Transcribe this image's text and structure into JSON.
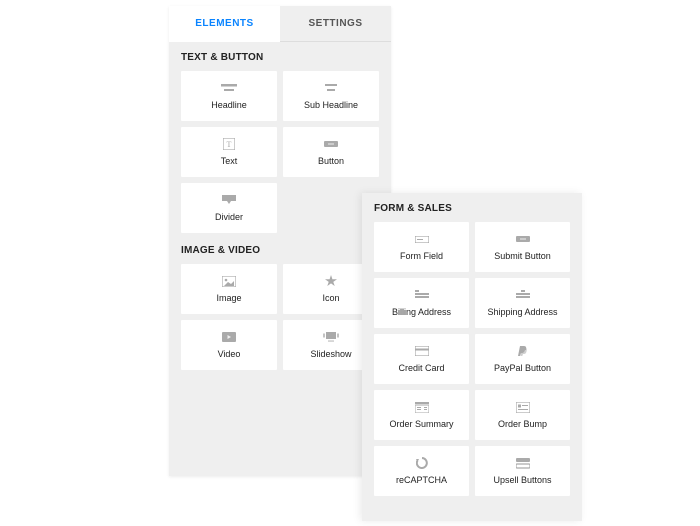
{
  "tabs": {
    "elements": "ELEMENTS",
    "settings": "SETTINGS"
  },
  "sections": {
    "text_button": {
      "title": "TEXT & BUTTON",
      "items": [
        {
          "label": "Headline",
          "icon": "headline-icon"
        },
        {
          "label": "Sub Headline",
          "icon": "subheadline-icon"
        },
        {
          "label": "Text",
          "icon": "text-icon"
        },
        {
          "label": "Button",
          "icon": "button-icon"
        },
        {
          "label": "Divider",
          "icon": "divider-icon"
        }
      ]
    },
    "image_video": {
      "title": "IMAGE & VIDEO",
      "items": [
        {
          "label": "Image",
          "icon": "image-icon"
        },
        {
          "label": "Icon",
          "icon": "star-icon"
        },
        {
          "label": "Video",
          "icon": "video-icon"
        },
        {
          "label": "Slideshow",
          "icon": "slideshow-icon"
        }
      ]
    },
    "form_sales": {
      "title": "FORM & SALES",
      "items": [
        {
          "label": "Form Field",
          "icon": "form-field-icon"
        },
        {
          "label": "Submit Button",
          "icon": "submit-button-icon"
        },
        {
          "label": "Billing Address",
          "icon": "billing-address-icon"
        },
        {
          "label": "Shipping Address",
          "icon": "shipping-address-icon"
        },
        {
          "label": "Credit Card",
          "icon": "credit-card-icon"
        },
        {
          "label": "PayPal Button",
          "icon": "paypal-icon"
        },
        {
          "label": "Order Summary",
          "icon": "order-summary-icon"
        },
        {
          "label": "Order Bump",
          "icon": "order-bump-icon"
        },
        {
          "label": "reCAPTCHA",
          "icon": "recaptcha-icon"
        },
        {
          "label": "Upsell Buttons",
          "icon": "upsell-icon"
        }
      ]
    }
  }
}
